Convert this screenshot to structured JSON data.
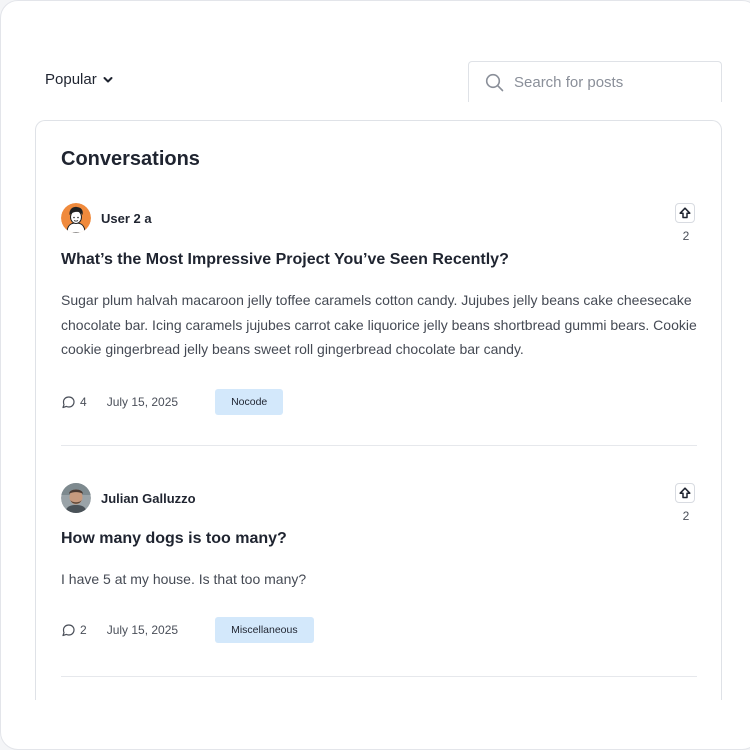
{
  "toolbar": {
    "sort_label": "Popular",
    "search_placeholder": "Search for posts",
    "search_value": ""
  },
  "section": {
    "title": "Conversations"
  },
  "posts": [
    {
      "author": "User 2 a",
      "avatar_icon": "cartoon-avatar",
      "title": "What’s the Most Impressive Project You’ve Seen Recently?",
      "body": "Sugar plum halvah macaroon jelly toffee caramels cotton candy. Jujubes jelly beans cake cheesecake chocolate bar. Icing caramels jujubes carrot cake liquorice jelly beans shortbread gummi bears. Cookie cookie gingerbread jelly beans sweet roll gingerbread chocolate bar candy.",
      "comments": "4",
      "date": "July 15, 2025",
      "tag": "Nocode",
      "votes": "2"
    },
    {
      "author": "Julian Galluzzo",
      "avatar_icon": "photo-avatar",
      "title": "How many dogs is too many?",
      "body": "I have 5 at my house. Is that too many?",
      "comments": "2",
      "date": "July 15, 2025",
      "tag": "Miscellaneous",
      "votes": "2"
    }
  ],
  "colors": {
    "tag_background": "#d3e8fb",
    "text_primary": "#1f2430",
    "text_secondary": "#454a54",
    "border": "#dfe2e7"
  }
}
